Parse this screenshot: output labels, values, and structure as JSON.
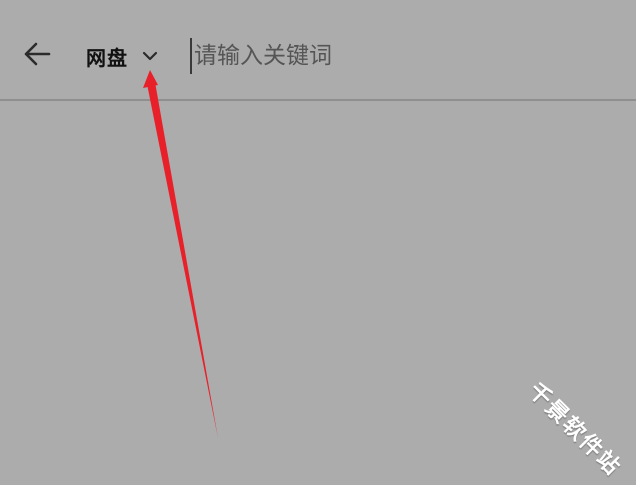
{
  "header": {
    "back_icon": "back-arrow-icon",
    "scope_label": "网盘",
    "scope_chevron_icon": "chevron-down-icon",
    "search_placeholder": "请输入关键词",
    "search_value": ""
  },
  "annotation": {
    "arrow_color": "#e8202a"
  },
  "watermark": {
    "text": "千景软件站"
  },
  "colors": {
    "background": "#acacac",
    "divider": "#8f8f8f"
  }
}
